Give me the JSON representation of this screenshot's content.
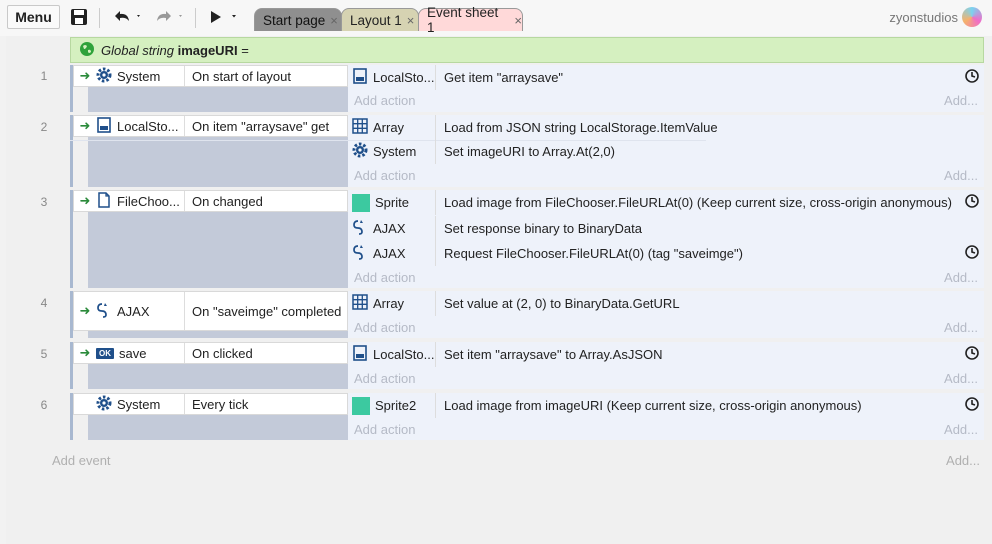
{
  "toolbar": {
    "menu_label": "Menu",
    "brand": "zyonstudios",
    "tabs": [
      {
        "label": "Start page",
        "close": "×"
      },
      {
        "label": "Layout 1",
        "close": "×"
      },
      {
        "label": "Event sheet 1",
        "close": "×"
      }
    ]
  },
  "global": {
    "prefix": "Global string",
    "name": "imageURI",
    "suffix": "="
  },
  "events": [
    {
      "number": "1",
      "condition": {
        "object": "System",
        "icon": "gear-icon",
        "text": "On start of layout"
      },
      "actions": [
        {
          "object": "LocalSto...",
          "icon": "storage-icon",
          "text": "Get item \"arraysave\""
        }
      ]
    },
    {
      "number": "2",
      "condition": {
        "object": "LocalSto...",
        "icon": "storage-icon",
        "text": "On item \"arraysave\" get"
      },
      "actions": [
        {
          "object": "Array",
          "icon": "array-grid-icon",
          "text": "Load from JSON string LocalStorage.ItemValue"
        },
        {
          "object": "System",
          "icon": "gear-icon",
          "text": "Set imageURI to Array.At(2,0)"
        }
      ]
    },
    {
      "number": "3",
      "condition": {
        "object": "FileChoo...",
        "icon": "file-icon",
        "text": "On changed"
      },
      "actions": [
        {
          "object": "Sprite",
          "icon": "sprite-icon",
          "text": "Load image from FileChooser.FileURLAt(0) (Keep current size, cross-origin anonymous)"
        },
        {
          "object": "AJAX",
          "icon": "ajax-icon",
          "text": "Set response binary to BinaryData"
        },
        {
          "object": "AJAX",
          "icon": "ajax-icon",
          "text": "Request FileChooser.FileURLAt(0) (tag \"saveimge\")"
        }
      ]
    },
    {
      "number": "4",
      "condition": {
        "object": "AJAX",
        "icon": "ajax-icon",
        "text": "On \"saveimge\" completed"
      },
      "actions": [
        {
          "object": "Array",
          "icon": "array-grid-icon",
          "text": "Set value at (2, 0) to BinaryData.GetURL"
        }
      ]
    },
    {
      "number": "5",
      "condition": {
        "object": "save",
        "icon": "button-ok-icon",
        "text": "On clicked"
      },
      "actions": [
        {
          "object": "LocalSto...",
          "icon": "storage-icon",
          "text": "Set item \"arraysave\" to Array.AsJSON"
        }
      ]
    },
    {
      "number": "6",
      "condition": {
        "object": "System",
        "icon": "gear-icon",
        "text": "Every tick"
      },
      "actions": [
        {
          "object": "Sprite2",
          "icon": "sprite-icon",
          "text": "Load image from imageURI (Keep current size, cross-origin anonymous)"
        }
      ]
    }
  ],
  "labels": {
    "add_action": "Add action",
    "add_ellipsis": "Add...",
    "add_event": "Add event",
    "ok_badge": "OK"
  },
  "colors": {
    "global_bg": "#d5f0c0",
    "action_bg": "#eef2fa",
    "condition_side": "#c3cad9",
    "sprite": "#3cc9a0",
    "tab_active_bg": "#ffd9d9"
  }
}
